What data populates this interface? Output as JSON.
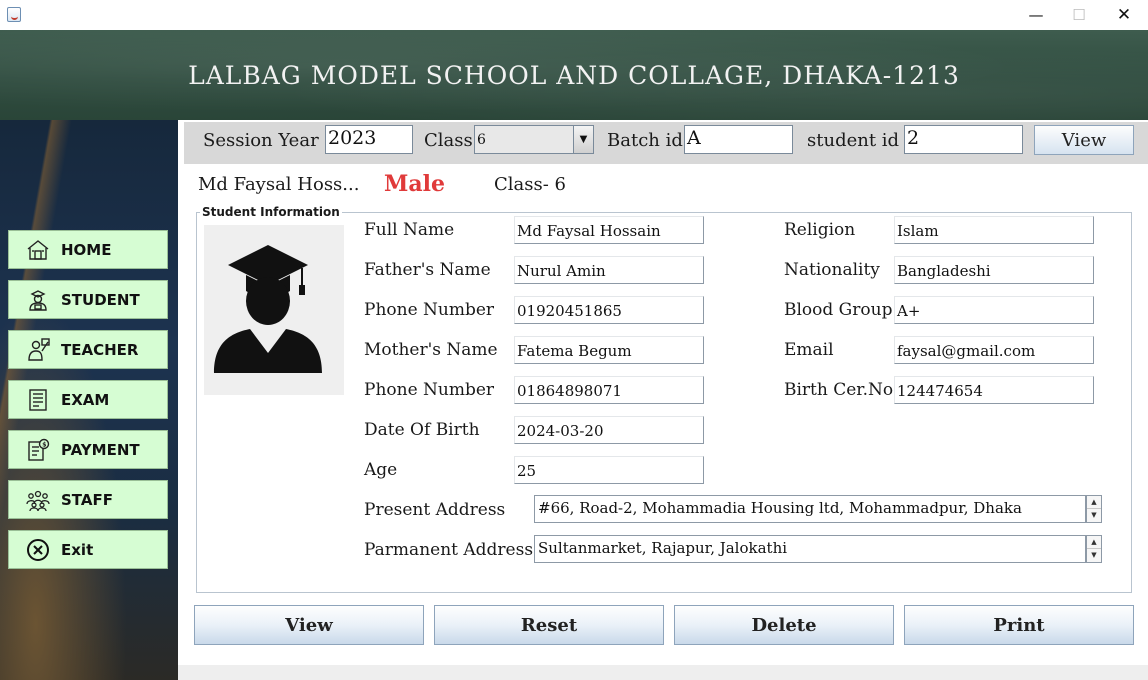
{
  "window": {
    "minimize": "—",
    "maximize": "☐",
    "close": "✕"
  },
  "banner": {
    "title": "LALBAG MODEL SCHOOL AND COLLAGE, DHAKA-1213"
  },
  "sidebar": {
    "items": [
      {
        "label": "HOME",
        "icon": "home-icon"
      },
      {
        "label": "STUDENT",
        "icon": "student-icon"
      },
      {
        "label": "TEACHER",
        "icon": "teacher-icon"
      },
      {
        "label": "EXAM",
        "icon": "exam-icon"
      },
      {
        "label": "PAYMENT",
        "icon": "payment-icon"
      },
      {
        "label": "STAFF",
        "icon": "staff-icon"
      },
      {
        "label": "Exit",
        "icon": "exit-icon"
      }
    ],
    "button_color": "#d6fdd3"
  },
  "filter": {
    "session_year_label": "Session Year",
    "session_year_value": "2023",
    "class_label": "Class",
    "class_value": "6",
    "batch_label": "Batch id",
    "batch_value": "A",
    "student_id_label": "student id",
    "student_id_value": "2",
    "view_label": "View"
  },
  "summary": {
    "name": "Md Faysal Hoss...",
    "gender": "Male",
    "class": "Class- 6",
    "gender_color": "#e03a3a"
  },
  "info": {
    "legend": "Student Information",
    "full_name_label": "Full Name",
    "full_name": "Md Faysal Hossain",
    "father_label": "Father's Name",
    "father": "Nurul Amin",
    "phone1_label": "Phone Number",
    "phone1": "01920451865",
    "mother_label": "Mother's Name",
    "mother": "Fatema Begum",
    "phone2_label": "Phone Number",
    "phone2": "01864898071",
    "dob_label": "Date Of Birth",
    "dob": "2024-03-20",
    "age_label": "Age",
    "age": "25",
    "religion_label": "Religion",
    "religion": "Islam",
    "nationality_label": "Nationality",
    "nationality": "Bangladeshi",
    "blood_label": "Blood Group",
    "blood": "A+",
    "email_label": "Email",
    "email": "faysal@gmail.com",
    "birth_cert_label": "Birth Cer.No",
    "birth_cert": "124474654",
    "present_address_label": "Present Address",
    "present_address": "#66, Road-2, Mohammadia Housing ltd, Mohammadpur, Dhaka",
    "permanent_address_label": "Parmanent Address",
    "permanent_address": "Sultanmarket, Rajapur, Jalokathi"
  },
  "actions": {
    "view": "View",
    "reset": "Reset",
    "delete": "Delete",
    "print": "Print"
  }
}
